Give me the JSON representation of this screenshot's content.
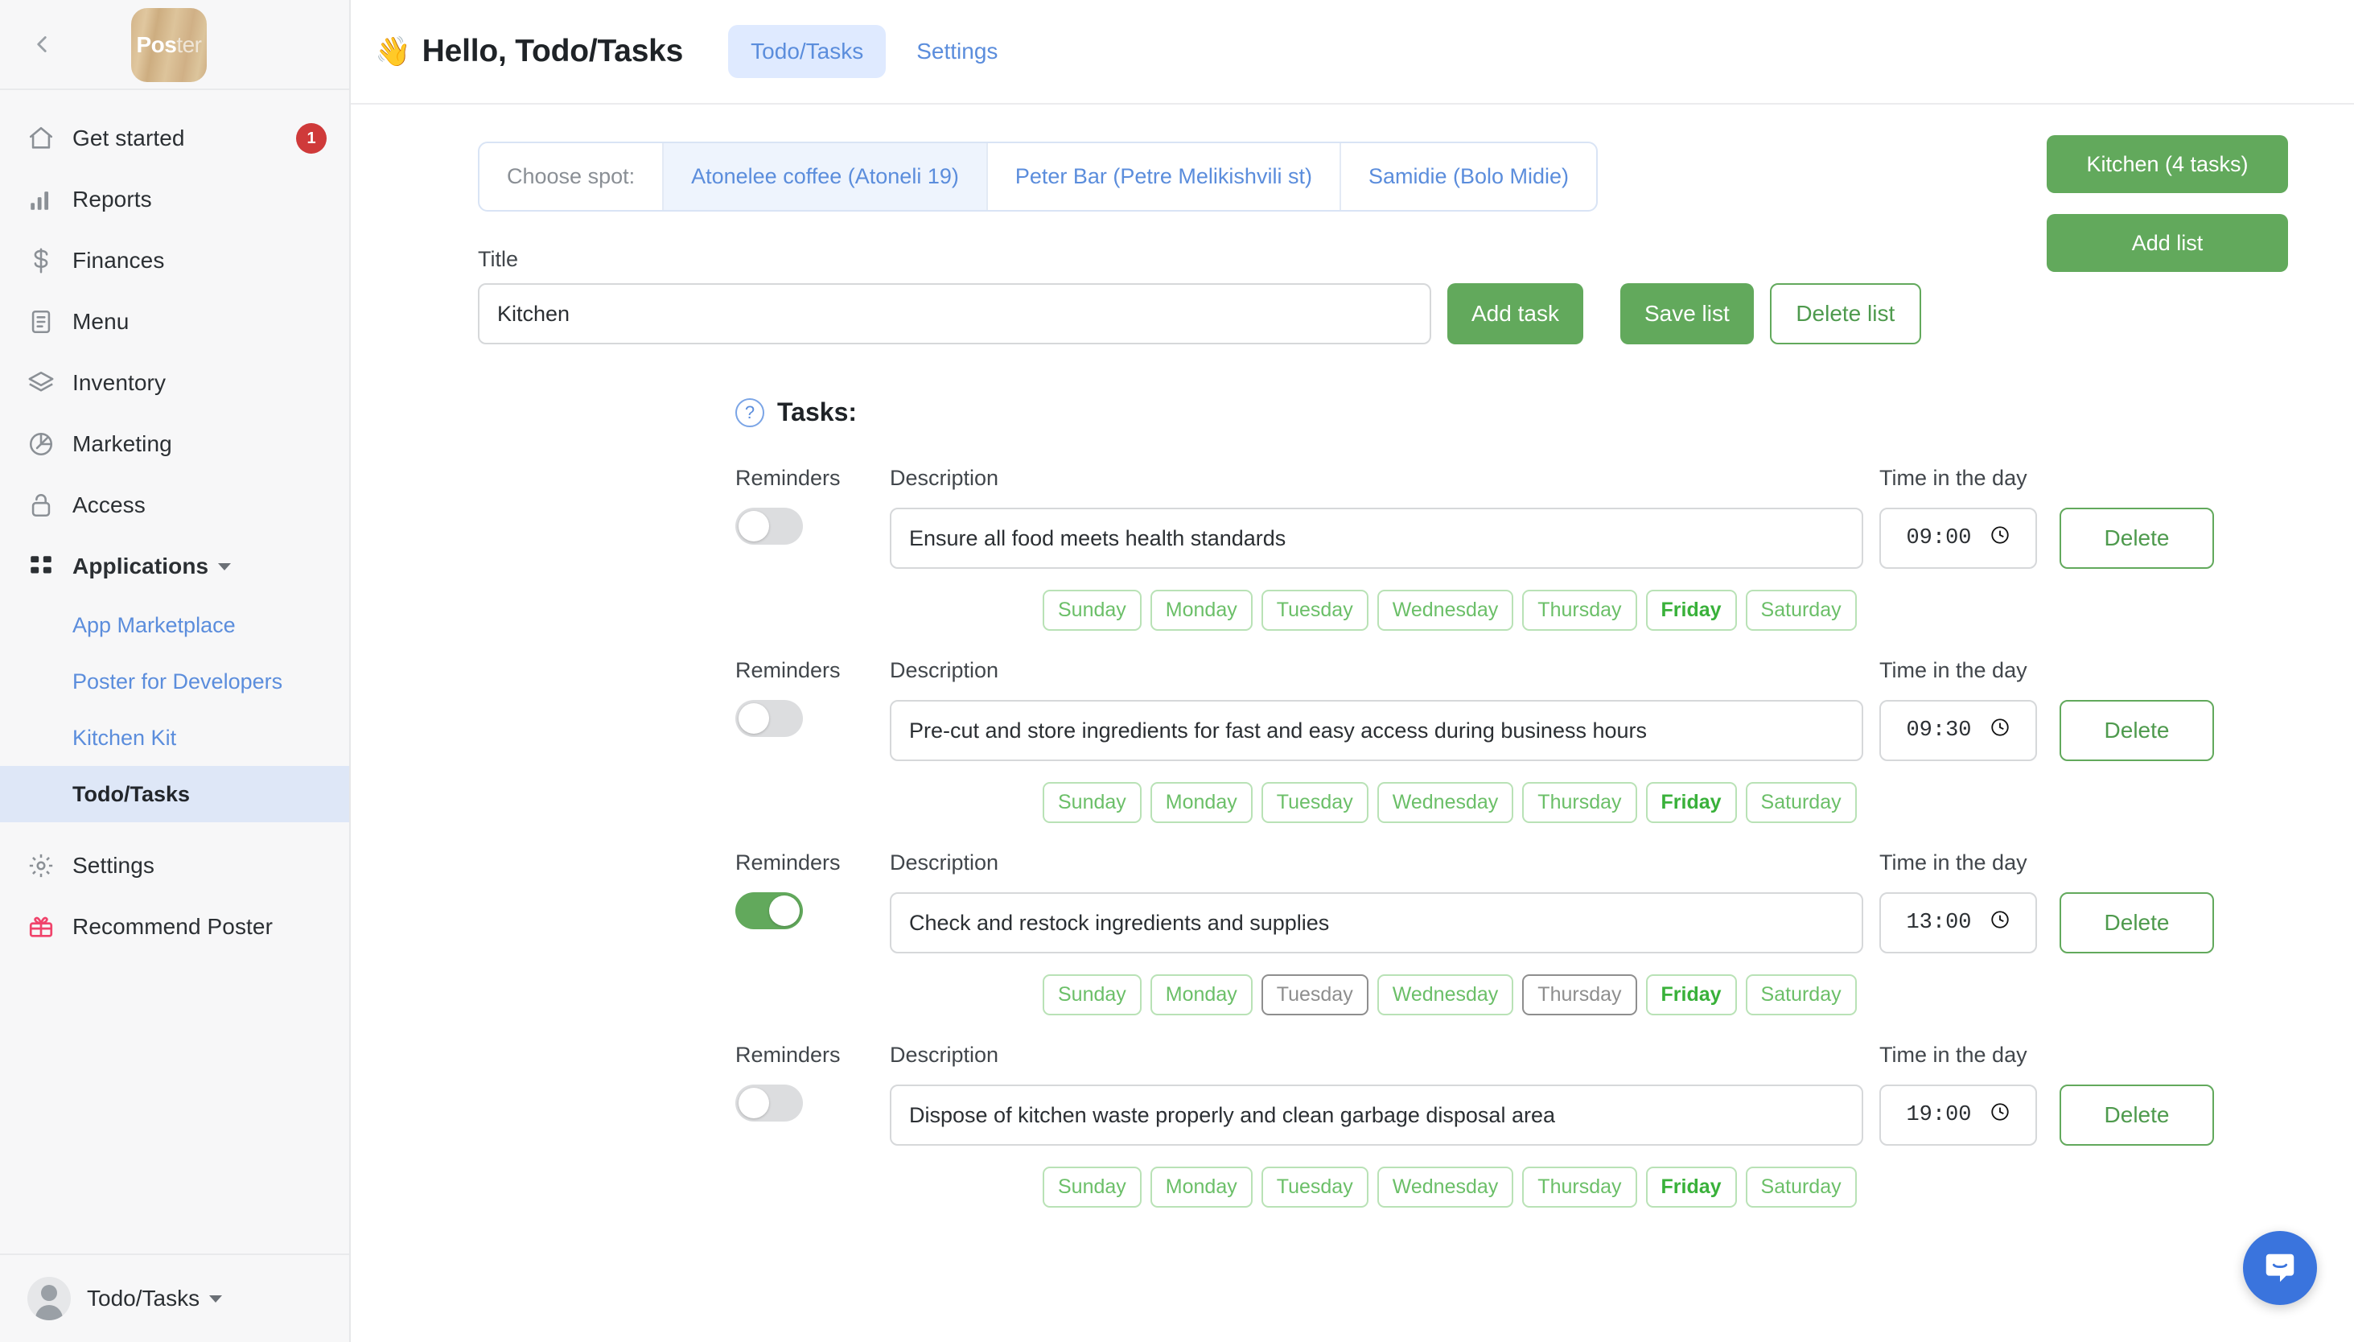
{
  "sidebar": {
    "logo": {
      "bold": "Pos",
      "light": "ter"
    },
    "back_icon": "chevron-left-icon",
    "lamp_icon": "lamp-icon",
    "items": [
      {
        "label": "Get started",
        "icon": "home-icon",
        "badge": "1"
      },
      {
        "label": "Reports",
        "icon": "bar-chart-icon"
      },
      {
        "label": "Finances",
        "icon": "dollar-icon"
      },
      {
        "label": "Menu",
        "icon": "document-icon"
      },
      {
        "label": "Inventory",
        "icon": "layers-icon"
      },
      {
        "label": "Marketing",
        "icon": "megaphone-icon"
      },
      {
        "label": "Access",
        "icon": "lock-icon"
      },
      {
        "label": "Applications",
        "icon": "grid-icon"
      }
    ],
    "sub_items": [
      {
        "label": "App Marketplace"
      },
      {
        "label": "Poster for Developers"
      },
      {
        "label": "Kitchen Kit"
      },
      {
        "label": "Todo/Tasks"
      }
    ],
    "bottom_items": [
      {
        "label": "Settings",
        "icon": "gear-icon"
      },
      {
        "label": "Recommend Poster",
        "icon": "gift-icon"
      }
    ],
    "user": {
      "name": "Todo/Tasks",
      "avatar": "user-avatar-icon"
    }
  },
  "header": {
    "wave": "👋",
    "title": "Hello, Todo/Tasks",
    "tabs": [
      {
        "label": "Todo/Tasks",
        "active": true
      },
      {
        "label": "Settings",
        "active": false
      }
    ]
  },
  "spots": {
    "label": "Choose spot:",
    "options": [
      {
        "label": "Atonelee coffee (Atoneli 19)",
        "active": true
      },
      {
        "label": "Peter Bar (Petre Melikishvili st)",
        "active": false
      },
      {
        "label": "Samidie (Bolo Midie)",
        "active": false
      }
    ]
  },
  "list_form": {
    "title_label": "Title",
    "title_value": "Kitchen",
    "title_placeholder": "Title",
    "add_task_label": "Add task",
    "save_list_label": "Save list",
    "delete_list_label": "Delete list"
  },
  "right_actions": {
    "current_list_label": "Kitchen (4 tasks)",
    "add_list_label": "Add list"
  },
  "tasks_section": {
    "help_icon": "question-mark-icon",
    "heading": "Tasks:",
    "col_reminders": "Reminders",
    "col_description": "Description",
    "col_time": "Time in the day",
    "delete_label": "Delete",
    "clock_icon": "clock-icon",
    "weekdays": [
      "Sunday",
      "Monday",
      "Tuesday",
      "Wednesday",
      "Thursday",
      "Friday",
      "Saturday"
    ]
  },
  "tasks": [
    {
      "reminder_on": false,
      "description": "Ensure all food meets health standards",
      "time": "09:00",
      "days": [
        {
          "label": "Sunday",
          "state": "normal"
        },
        {
          "label": "Monday",
          "state": "normal"
        },
        {
          "label": "Tuesday",
          "state": "normal"
        },
        {
          "label": "Wednesday",
          "state": "normal"
        },
        {
          "label": "Thursday",
          "state": "normal"
        },
        {
          "label": "Friday",
          "state": "selected"
        },
        {
          "label": "Saturday",
          "state": "normal"
        }
      ]
    },
    {
      "reminder_on": false,
      "description": "Pre-cut and store ingredients for fast and easy access during business hours",
      "time": "09:30",
      "days": [
        {
          "label": "Sunday",
          "state": "normal"
        },
        {
          "label": "Monday",
          "state": "normal"
        },
        {
          "label": "Tuesday",
          "state": "normal"
        },
        {
          "label": "Wednesday",
          "state": "normal"
        },
        {
          "label": "Thursday",
          "state": "normal"
        },
        {
          "label": "Friday",
          "state": "selected"
        },
        {
          "label": "Saturday",
          "state": "normal"
        }
      ]
    },
    {
      "reminder_on": true,
      "description": "Check and restock ingredients and supplies",
      "time": "13:00",
      "days": [
        {
          "label": "Sunday",
          "state": "normal"
        },
        {
          "label": "Monday",
          "state": "normal"
        },
        {
          "label": "Tuesday",
          "state": "off"
        },
        {
          "label": "Wednesday",
          "state": "normal"
        },
        {
          "label": "Thursday",
          "state": "off"
        },
        {
          "label": "Friday",
          "state": "selected"
        },
        {
          "label": "Saturday",
          "state": "normal"
        }
      ]
    },
    {
      "reminder_on": false,
      "description": "Dispose of kitchen waste properly and clean garbage disposal area",
      "time": "19:00",
      "days": [
        {
          "label": "Sunday",
          "state": "normal"
        },
        {
          "label": "Monday",
          "state": "normal"
        },
        {
          "label": "Tuesday",
          "state": "normal"
        },
        {
          "label": "Wednesday",
          "state": "normal"
        },
        {
          "label": "Thursday",
          "state": "normal"
        },
        {
          "label": "Friday",
          "state": "selected"
        },
        {
          "label": "Saturday",
          "state": "normal"
        }
      ]
    }
  ],
  "chat": {
    "icon": "chat-bubble-icon"
  },
  "colors": {
    "green": "#62a95c",
    "blue": "#5b8ddc",
    "active_blue_bg": "#dee7f7",
    "badge_red": "#cf3a3a",
    "chat_blue": "#3a74dd"
  }
}
